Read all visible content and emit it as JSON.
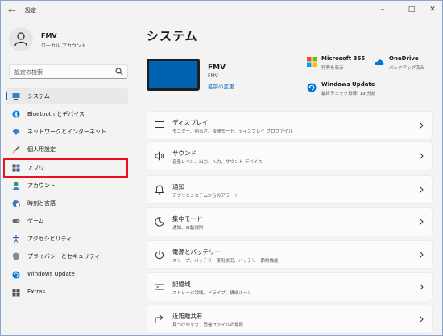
{
  "window": {
    "title": "設定"
  },
  "profile": {
    "name": "FMV",
    "account_type": "ローカル アカウント"
  },
  "search": {
    "placeholder": "設定の検索"
  },
  "sidebar": {
    "items": [
      {
        "label": "システム",
        "icon": "monitor-icon",
        "active": true
      },
      {
        "label": "Bluetooth とデバイス",
        "icon": "bluetooth-icon"
      },
      {
        "label": "ネットワークとインターネット",
        "icon": "wifi-icon"
      },
      {
        "label": "個人用設定",
        "icon": "paintbrush-icon"
      },
      {
        "label": "アプリ",
        "icon": "apps-icon"
      },
      {
        "label": "アカウント",
        "icon": "person-icon"
      },
      {
        "label": "時刻と言語",
        "icon": "globe-clock-icon"
      },
      {
        "label": "ゲーム",
        "icon": "gamepad-icon"
      },
      {
        "label": "アクセシビリティ",
        "icon": "accessibility-icon"
      },
      {
        "label": "プライバシーとセキュリティ",
        "icon": "shield-icon"
      },
      {
        "label": "Windows Update",
        "icon": "update-icon"
      },
      {
        "label": "Extras",
        "icon": "extras-icon"
      }
    ]
  },
  "main": {
    "title": "システム",
    "device": {
      "name": "FMV",
      "model": "FMV",
      "rename_link": "名前の変更"
    },
    "quick_info": [
      {
        "title": "Microsoft 365",
        "subtitle": "特典を表示",
        "icon": "microsoft-365-icon"
      },
      {
        "title": "OneDrive",
        "subtitle": "バックアップ済み",
        "icon": "onedrive-icon"
      },
      {
        "title": "Windows Update",
        "subtitle": "最終チェック日時: 19 分前",
        "icon": "windows-update-icon"
      }
    ],
    "cards": [
      {
        "title": "ディスプレイ",
        "subtitle": "モニター、明るさ、夜間モード、ディスプレイ プロファイル",
        "icon": "display-icon"
      },
      {
        "title": "サウンド",
        "subtitle": "音量レベル、出力、入力、サウンド デバイス",
        "icon": "speaker-icon"
      },
      {
        "title": "通知",
        "subtitle": "アプリとシステムからのアラート",
        "icon": "bell-icon"
      },
      {
        "title": "集中モード",
        "subtitle": "通知、自動規則",
        "icon": "moon-icon"
      },
      {
        "title": "電源とバッテリー",
        "subtitle": "スリープ、バッテリー使用状況、バッテリー節約機能",
        "icon": "power-icon"
      },
      {
        "title": "記憶域",
        "subtitle": "ストレージ領域、ドライブ、構成ルール",
        "icon": "storage-icon"
      },
      {
        "title": "近距離共有",
        "subtitle": "見つけやすさ、受信ファイルの場所",
        "icon": "share-icon"
      }
    ]
  },
  "colors": {
    "accent": "#005fb8",
    "highlight_box": "#e81123",
    "device_screen": "#0063b1"
  }
}
